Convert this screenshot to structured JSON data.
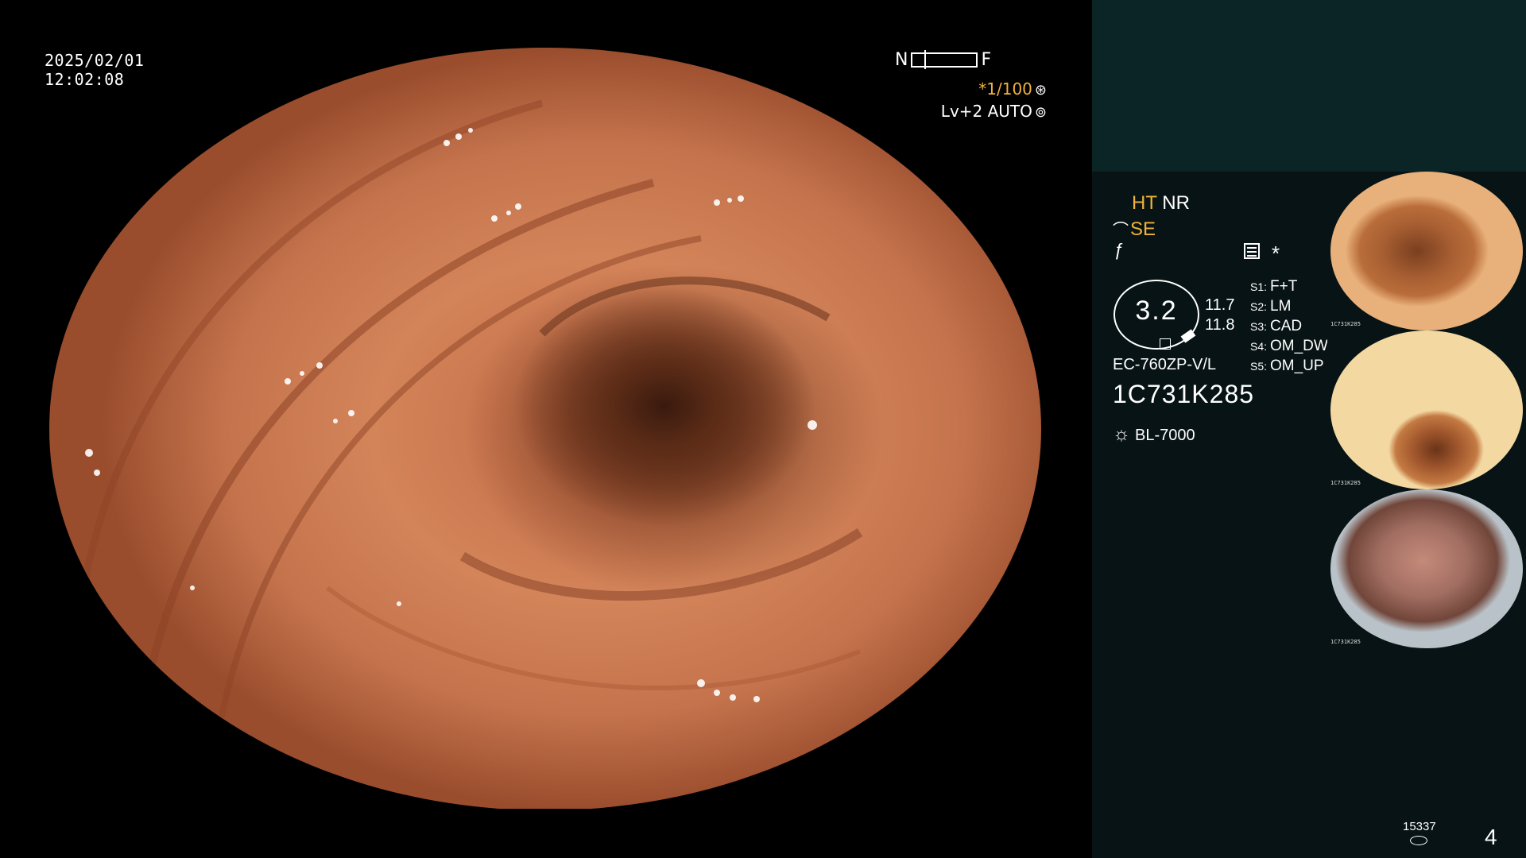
{
  "overlay": {
    "date": "2025/02/01",
    "time": "12:02:08",
    "scale_left": "N",
    "scale_right": "F",
    "shutter": "*1/100",
    "shutter_icon": "aperture-icon",
    "level": "Lv+2 AUTO",
    "level_icon": "iris-icon"
  },
  "status": {
    "ht": "HT",
    "nr": "NR",
    "se": "SE",
    "se_symbol": "⌒",
    "f_symbol": "ƒ",
    "star": "*"
  },
  "badge": {
    "value": "3.2",
    "v1": "11.7",
    "v2": "11.8"
  },
  "device": {
    "scope_model": "EC-760ZP-V/L",
    "serial": "1C731K285",
    "light_source": "BL-7000",
    "light_icon": "sun-icon"
  },
  "settings": [
    {
      "key": "S1:",
      "value": "F+T"
    },
    {
      "key": "S2:",
      "value": "LM"
    },
    {
      "key": "S3:",
      "value": "CAD"
    },
    {
      "key": "S4:",
      "value": "OM_DW"
    },
    {
      "key": "S5:",
      "value": "OM_UP"
    }
  ],
  "thumbnails": [
    {
      "label": "1C731K285"
    },
    {
      "label": "1C731K285"
    },
    {
      "label": "1C731K285"
    }
  ],
  "footer": {
    "count": "15337",
    "page": "4"
  },
  "colors": {
    "accent_orange": "#f0b23a",
    "panel_dark": "#071314",
    "panel_teal": "#0b2527"
  }
}
